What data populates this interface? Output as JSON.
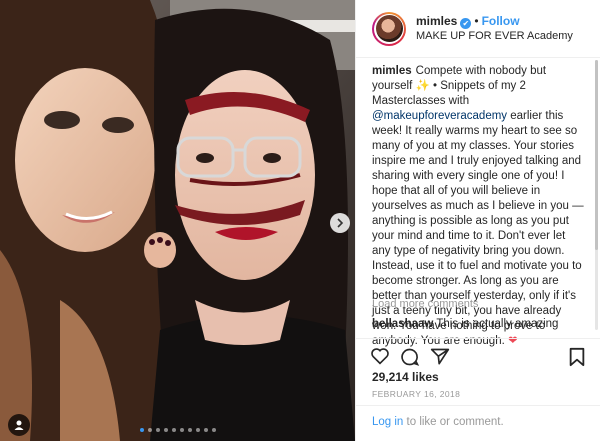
{
  "header": {
    "username": "mimles",
    "verified_glyph": "✔",
    "separator": "•",
    "follow_label": "Follow",
    "location": "MAKE UP FOR EVER Academy"
  },
  "caption": {
    "username": "mimles",
    "part1": "Compete with nobody but yourself ",
    "emoji1": "✨",
    "part2": " • Snippets of my 2 Masterclasses with ",
    "mention": "@makeupforeveracademy",
    "part3": " earlier this week! It really warms my heart to see so many of you at my classes. Your stories inspire me and I truly enjoyed talking and sharing with every single one of you! I hope that all of you will believe in yourselves as much as I believe in you — anything is possible as long as you put your mind and time to it. Don't ever let any type of negativity bring you down. Instead, use it to fuel and motivate you to become stronger. As long as you are better than yourself yesterday, only if it's just a teeny tiny bit, you have already won. You have nothing to prove to anybody. You are enough. ",
    "emoji2": "❤"
  },
  "load_more": "Load more comments",
  "comment": {
    "username": "bellashaaw",
    "text": "This is actually amazing"
  },
  "likes": "29,214 likes",
  "date": "FEBRUARY 16, 2018",
  "login": {
    "login_link": "Log in",
    "rest": " to like or comment."
  },
  "icons": {
    "like": "heart-outline-icon",
    "comment": "comment-bubble-icon",
    "share": "share-plane-icon",
    "save": "bookmark-icon",
    "next": "chevron-right-icon",
    "tag": "user-tag-icon"
  },
  "carousel": {
    "count": 10,
    "active_index": 0
  },
  "colors": {
    "link": "#3897f0",
    "accent_heart": "#ed4956",
    "mention": "#003569"
  }
}
